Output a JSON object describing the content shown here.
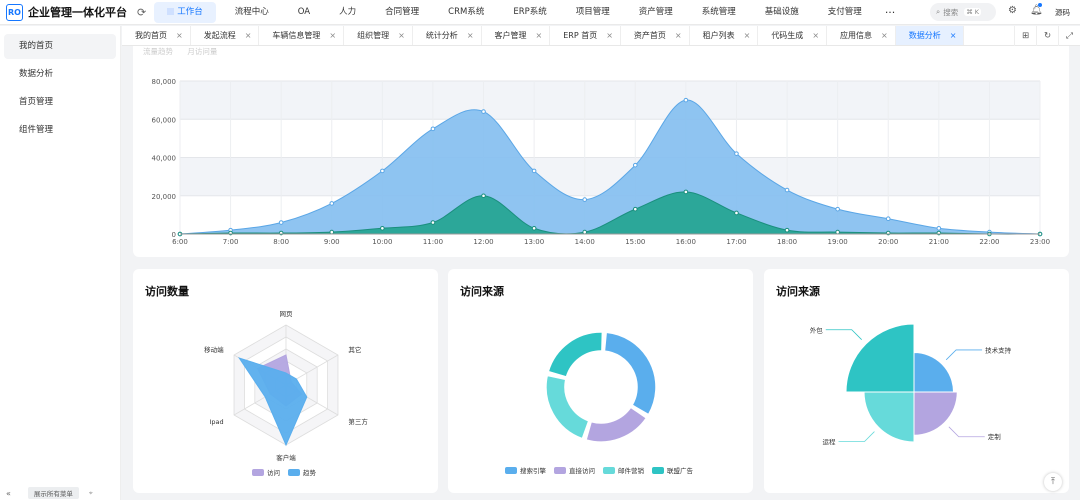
{
  "app": {
    "logo": "RO",
    "title": "企业管理一体化平台"
  },
  "menu": {
    "items": [
      {
        "label": "工作台",
        "active": true
      },
      {
        "label": "流程中心"
      },
      {
        "label": "OA"
      },
      {
        "label": "人力"
      },
      {
        "label": "合同管理"
      },
      {
        "label": "CRM系统"
      },
      {
        "label": "ERP系统"
      },
      {
        "label": "项目管理"
      },
      {
        "label": "资产管理"
      },
      {
        "label": "系统管理"
      },
      {
        "label": "基础设施"
      },
      {
        "label": "支付管理"
      }
    ],
    "more": "···"
  },
  "search": {
    "placeholder": "搜索",
    "shortcut": "⌘ K"
  },
  "user": {
    "name": "源码"
  },
  "sidebar": {
    "items": [
      {
        "label": "我的首页",
        "active": true
      },
      {
        "label": "数据分析"
      },
      {
        "label": "首页管理"
      },
      {
        "label": "组件管理"
      }
    ],
    "show_all": "展示所有菜单"
  },
  "tabs": [
    {
      "label": "我的首页"
    },
    {
      "label": "发起流程"
    },
    {
      "label": "车辆信息管理"
    },
    {
      "label": "组织管理"
    },
    {
      "label": "统计分析"
    },
    {
      "label": "客户管理"
    },
    {
      "label": "ERP 首页"
    },
    {
      "label": "资产首页"
    },
    {
      "label": "租户列表"
    },
    {
      "label": "代码生成"
    },
    {
      "label": "应用信息"
    },
    {
      "label": "数据分析",
      "active": true
    }
  ],
  "top_chart_tabs": [
    "流量趋势",
    "月访问量"
  ],
  "colors": {
    "accent": "#1677ff",
    "area_light": "#86bff0",
    "area_dark": "#27a593",
    "pie_blue": "#5aaeed",
    "pie_purple": "#b3a5e0",
    "pie_cyan": "#66dada",
    "pie_teal": "#2ec4c4"
  },
  "chart_data": [
    {
      "type": "area",
      "x": [
        "6:00",
        "7:00",
        "8:00",
        "9:00",
        "10:00",
        "11:00",
        "12:00",
        "13:00",
        "14:00",
        "15:00",
        "16:00",
        "17:00",
        "18:00",
        "19:00",
        "20:00",
        "21:00",
        "22:00",
        "23:00"
      ],
      "series": [
        {
          "values": [
            0,
            2000,
            6000,
            16000,
            33000,
            55000,
            64000,
            33000,
            18000,
            36000,
            70000,
            42000,
            23000,
            13000,
            8000,
            3000,
            1000,
            0
          ]
        },
        {
          "values": [
            0,
            500,
            500,
            1000,
            3000,
            6000,
            20000,
            3000,
            1000,
            13000,
            22000,
            11000,
            2000,
            1000,
            500,
            500,
            0,
            0
          ]
        }
      ],
      "yticks": [
        "0",
        "20,000",
        "40,000",
        "60,000",
        "80,000"
      ],
      "ylim": [
        0,
        80000
      ],
      "grid": true
    },
    {
      "type": "radar",
      "title": "访问数量",
      "indicators": [
        "网页",
        "其它",
        "第三方",
        "客户端",
        "Ipad",
        "移动端"
      ],
      "max": 100,
      "series": [
        {
          "name": "访问",
          "values": [
            50,
            10,
            30,
            35,
            30,
            55
          ]
        },
        {
          "name": "趋势",
          "values": [
            20,
            20,
            40,
            100,
            40,
            90
          ]
        }
      ],
      "legend": "bottom"
    },
    {
      "type": "pie",
      "title": "访问来源",
      "variant": "donut",
      "slices": [
        {
          "name": "搜索引擎",
          "value": 33
        },
        {
          "name": "直接访问",
          "value": 21
        },
        {
          "name": "邮件营销",
          "value": 24
        },
        {
          "name": "联盟广告",
          "value": 22
        }
      ],
      "legend": "bottom"
    },
    {
      "type": "pie",
      "title": "访问来源",
      "variant": "rose",
      "slices": [
        {
          "name": "技术支持",
          "value": 50
        },
        {
          "name": "定制",
          "value": 60
        },
        {
          "name": "运程",
          "value": 80
        },
        {
          "name": "外包",
          "value": 120
        }
      ]
    }
  ]
}
